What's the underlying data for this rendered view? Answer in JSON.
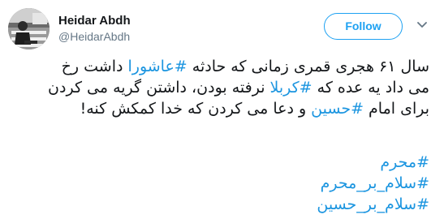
{
  "user": {
    "display_name": "Heidar Abdh",
    "username": "@HeidarAbdh",
    "avatar_icon": "profile-photo"
  },
  "follow_button": {
    "label": "Follow"
  },
  "menu": {
    "icon": "chevron-down-icon"
  },
  "tweet": {
    "lines": [
      {
        "before": "سال ۶۱ هجری قمری زمانی که حادثه ",
        "tag": "#عاشورا",
        "after": " داشت رخ"
      },
      {
        "before": "می داد یه عده که ",
        "tag": "#کربلا",
        "after": " نرفته بودن، داشتن گریه می کردن"
      },
      {
        "before": "برای امام ",
        "tag": "#حسین",
        "after": " و دعا می کردن که خدا کمکش کنه!"
      }
    ],
    "hashtags": [
      "#محرم",
      "#سلام_بر_محرم",
      "#سلام_بر_حسین"
    ]
  },
  "colors": {
    "link": "#1b95e0",
    "button": "#1da1f2",
    "text": "#14171a",
    "secondary": "#657786"
  }
}
